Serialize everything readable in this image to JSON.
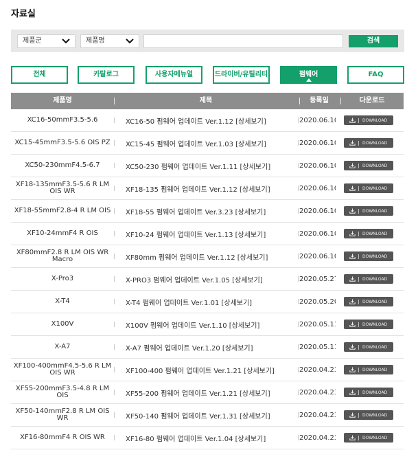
{
  "page": {
    "title": "자료실"
  },
  "filters": {
    "group_label": "제품군",
    "product_label": "제품명",
    "search_value": "",
    "search_button": "검색"
  },
  "tabs": [
    {
      "label": "전체",
      "active": false
    },
    {
      "label": "카탈로그",
      "active": false
    },
    {
      "label": "사용자메뉴얼",
      "active": false
    },
    {
      "label": "드라이버/유틸리티",
      "active": false
    },
    {
      "label": "펌웨어",
      "active": true
    },
    {
      "label": "FAQ",
      "active": false
    }
  ],
  "table": {
    "headers": {
      "product": "제품명",
      "title": "제목",
      "date": "등록일",
      "download": "다운로드"
    },
    "download_label": "DOWNLOAD",
    "rows": [
      {
        "product": "XC16-50mmF3.5-5.6",
        "title": "XC16-50 펌웨어 업데이트 Ver.1.12 [상세보기]",
        "date": "2020.06.10"
      },
      {
        "product": "XC15-45mmF3.5-5.6 OIS PZ",
        "title": "XC15-45 펌웨어 업데이트 Ver.1.03 [상세보기]",
        "date": "2020.06.10"
      },
      {
        "product": "XC50-230mmF4.5-6.7",
        "title": "XC50-230 펌웨어 업데이트 Ver.1.11 [상세보기]",
        "date": "2020.06.10"
      },
      {
        "product": "XF18-135mmF3.5-5.6 R LM OIS WR",
        "title": "XF18-135 펌웨어 업데이트 Ver.1.12 [상세보기]",
        "date": "2020.06.10"
      },
      {
        "product": "XF18-55mmF2.8-4 R LM OIS",
        "title": "XF18-55 펌웨어 업데이트 Ver.3.23 [상세보기]",
        "date": "2020.06.10"
      },
      {
        "product": "XF10-24mmF4 R OIS",
        "title": "XF10-24 펌웨어 업데이트 Ver.1.13 [상세보기]",
        "date": "2020.06.10"
      },
      {
        "product": "XF80mmF2.8 R LM OIS WR Macro",
        "title": "XF80mm 펌웨어 업데이트 Ver.1.12 [상세보기]",
        "date": "2020.06.10"
      },
      {
        "product": "X-Pro3",
        "title": "X-PRO3 펌웨어 업데이트 Ver.1.05 [상세보기]",
        "date": "2020.05.27"
      },
      {
        "product": "X-T4",
        "title": "X-T4 펌웨어 업데이트 Ver.1.01 [상세보기]",
        "date": "2020.05.20"
      },
      {
        "product": "X100V",
        "title": "X100V 펌웨어 업데이트 Ver.1.10 [상세보기]",
        "date": "2020.05.11"
      },
      {
        "product": "X-A7",
        "title": "X-A7 펌웨어 업데이트 Ver.1.20 [상세보기]",
        "date": "2020.05.11"
      },
      {
        "product": "XF100-400mmF4.5-5.6 R LM OIS WR",
        "title": "XF100-400 펌웨어 업데이트 Ver.1.21 [상세보기]",
        "date": "2020.04.23"
      },
      {
        "product": "XF55-200mmF3.5-4.8 R LM OIS",
        "title": "XF55-200 펌웨어 업데이트 Ver.1.21 [상세보기]",
        "date": "2020.04.23"
      },
      {
        "product": "XF50-140mmF2.8 R LM OIS WR",
        "title": "XF50-140 펌웨어 업데이트 Ver.1.31 [상세보기]",
        "date": "2020.04.23"
      },
      {
        "product": "XF16-80mmF4 R OIS WR",
        "title": "XF16-80 펌웨어 업데이트 Ver.1.04 [상세보기]",
        "date": "2020.04.23"
      }
    ]
  },
  "icons": {
    "chevron": "chevron-down-icon",
    "download": "download-icon"
  },
  "colors": {
    "accent": "#13a06a",
    "header_bg": "#8d8d8d",
    "download_bg": "#555555"
  }
}
